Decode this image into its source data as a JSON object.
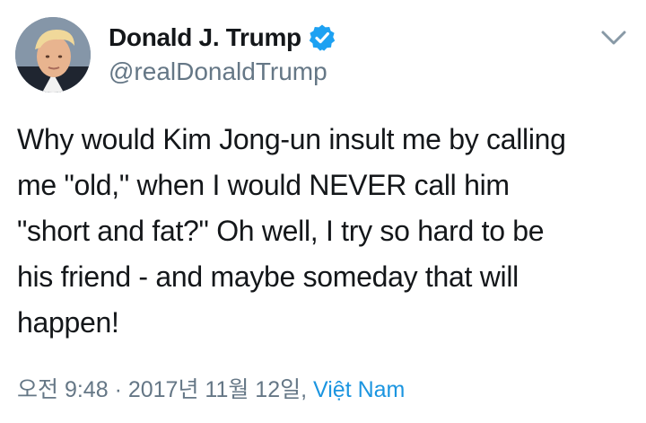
{
  "user": {
    "display_name": "Donald J. Trump",
    "handle": "@realDonaldTrump",
    "verified": true
  },
  "tweet": {
    "lines": [
      "Why would Kim Jong-un insult me by calling",
      "me \"old,\" when I would NEVER call him",
      "\"short and fat?\" Oh well, I try so hard to be",
      "his friend - and maybe someday that will",
      "happen!"
    ]
  },
  "meta": {
    "time": "오전 9:48",
    "separator": "·",
    "date": "2017년 11월 12일,",
    "location": "Việt Nam"
  },
  "icons": {
    "avatar": "profile-photo",
    "verified": "verified-badge-icon",
    "menu": "chevron-down-icon"
  },
  "colors": {
    "text": "#14171a",
    "secondary": "#657786",
    "link": "#1b95e0",
    "verified": "#1da1f2"
  }
}
